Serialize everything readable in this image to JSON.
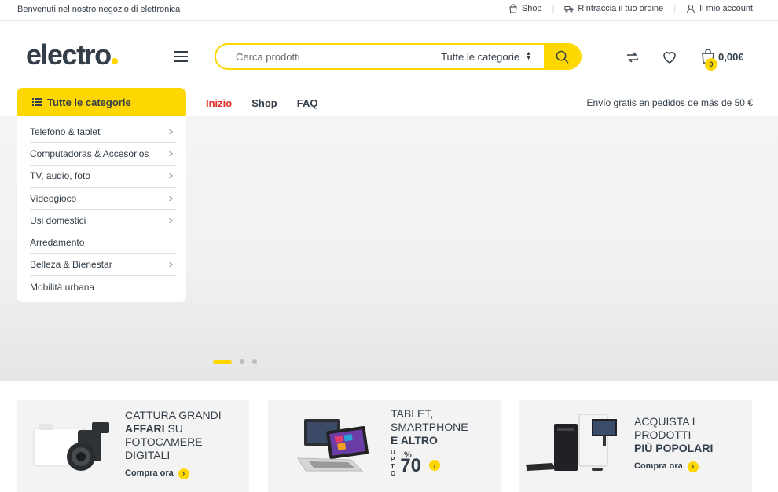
{
  "topbar": {
    "welcome": "Benvenuti nel nostro negozio di elettronica",
    "shop_link": "Shop",
    "track_link": "Rintraccia il tuo ordine",
    "account_link": "Il mio account"
  },
  "header": {
    "logo_text": "electro",
    "search_placeholder": "Cerca prodotti",
    "search_category": "Tutte le categorie",
    "cart_count": "0",
    "cart_amount": "0,00€"
  },
  "nav": {
    "all_categories": "Tutte le categorie",
    "links": [
      "Inizio",
      "Shop",
      "FAQ"
    ],
    "shipping_note": "Envío gratis en pedidos de más de 50 €"
  },
  "categories": [
    {
      "label": "Telefono & tablet",
      "has_sub": true
    },
    {
      "label": "Computadoras & Accesorios",
      "has_sub": true
    },
    {
      "label": "TV, audio, foto",
      "has_sub": true
    },
    {
      "label": "Videogioco",
      "has_sub": true
    },
    {
      "label": "Usi domestici",
      "has_sub": true
    },
    {
      "label": "Arredamento",
      "has_sub": false
    },
    {
      "label": "Belleza & Bienestar",
      "has_sub": true
    },
    {
      "label": "Mobilità urbana",
      "has_sub": false
    }
  ],
  "slider": {
    "total": 3,
    "active_index": 0
  },
  "banners": [
    {
      "line1": "CATTURA GRANDI",
      "bold": "AFFARI",
      "line2": " SU",
      "line3": "FOTOCAMERE",
      "line4": "DIGITALI",
      "cta": "Compra ora"
    },
    {
      "line1": "TABLET,",
      "line2": "SMARTPHONE",
      "bold": "E ALTRO",
      "upto": "UPTO",
      "percent_value": "70",
      "percent_sign": "%"
    },
    {
      "line1": "ACQUISTA I",
      "line2": "PRODOTTI",
      "bold": "PIÙ POPOLARI",
      "cta": "Compra ora"
    }
  ],
  "colors": {
    "accent": "#fed700",
    "active_nav": "#e02b27",
    "text": "#333e48"
  }
}
